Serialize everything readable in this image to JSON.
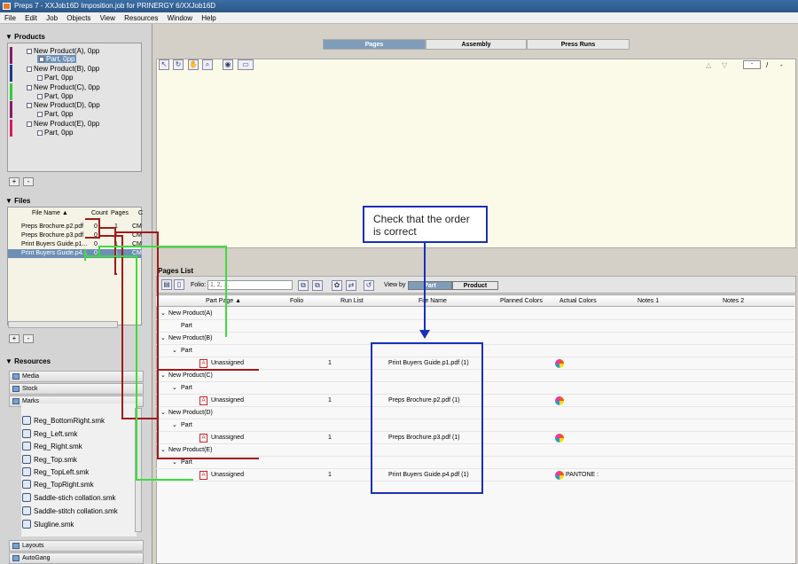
{
  "window": {
    "title": "Preps 7 - XXJob16D Imposition.job for PRINERGY 6/XXJob16D"
  },
  "menu": [
    "File",
    "Edit",
    "Job",
    "Objects",
    "View",
    "Resources",
    "Window",
    "Help"
  ],
  "products_section": {
    "title": "Products",
    "items": [
      {
        "name": "New Product(A), 0pp",
        "part": "Part, 0pp",
        "color": "#8b1a6b"
      },
      {
        "name": "New Product(B), 0pp",
        "part": "Part, 0pp",
        "color": "#1a3a8b"
      },
      {
        "name": "New Product(C), 0pp",
        "part": "Part, 0pp",
        "color": "#2ecc40"
      },
      {
        "name": "New Product(D), 0pp",
        "part": "Part, 0pp",
        "color": "#8b1a6b"
      },
      {
        "name": "New Product(E), 0pp",
        "part": "Part, 0pp",
        "color": "#d81b60"
      }
    ],
    "add_label": "+",
    "remove_label": "-"
  },
  "files_section": {
    "title": "Files",
    "columns": {
      "file_name": "File Name ▲",
      "count": "Count",
      "pages": "Pages",
      "c": "C"
    },
    "rows": [
      {
        "name": "Preps Brochure.p2.pdf",
        "count": "0",
        "pages": "1",
        "c": "CM"
      },
      {
        "name": "Preps Brochure.p3.pdf",
        "count": "0",
        "pages": "1",
        "c": "CM"
      },
      {
        "name": "Print Buyers Guide.p1...",
        "count": "0",
        "pages": "1",
        "c": "CM"
      },
      {
        "name": "Print Buyers Guide.p4...",
        "count": "0",
        "pages": "1",
        "c": "CM"
      }
    ],
    "add_label": "+",
    "remove_label": "-"
  },
  "resources_section": {
    "title": "Resources",
    "categories": [
      "Media",
      "Stock",
      "Marks"
    ],
    "marks": [
      "Reg_BottomRight.smk",
      "Reg_Left.smk",
      "Reg_Right.smk",
      "Reg_Top.smk",
      "Reg_TopLeft.smk",
      "Reg_TopRight.smk",
      "Saddle-stich collation.smk",
      "Saddle-stitch collation.smk",
      "Slugline.smk"
    ],
    "bottom_categories": [
      "Layouts",
      "AutoGang"
    ]
  },
  "tabs": [
    "Pages",
    "Assembly",
    "Press Runs"
  ],
  "page_nav": {
    "current": "-",
    "separator": "/",
    "total": "-"
  },
  "pages_list": {
    "title": "Pages List",
    "folio_label": "Folio:",
    "folio_placeholder": "1, 2, ...",
    "view_by_label": "View by",
    "view_by_options": [
      "Part",
      "Product"
    ],
    "columns": [
      "Part Page ▲",
      "Folio",
      "Run List",
      "File Name",
      "Planned Colors",
      "Actual Colors",
      "Notes 1",
      "Notes 2"
    ],
    "rows": [
      {
        "level": 0,
        "label": "New Product(A)"
      },
      {
        "level": 1,
        "label": "Part"
      },
      {
        "level": 0,
        "label": "New Product(B)"
      },
      {
        "level": 1,
        "label": "Part"
      },
      {
        "level": 2,
        "label": "Unassigned",
        "run": "1",
        "file": "Print Buyers Guide.p1.pdf (1)",
        "colors": ""
      },
      {
        "level": 0,
        "label": "New Product(C)"
      },
      {
        "level": 1,
        "label": "Part"
      },
      {
        "level": 2,
        "label": "Unassigned",
        "run": "1",
        "file": "Preps Brochure.p2.pdf (1)",
        "colors": ""
      },
      {
        "level": 0,
        "label": "New Product(D)"
      },
      {
        "level": 1,
        "label": "Part"
      },
      {
        "level": 2,
        "label": "Unassigned",
        "run": "1",
        "file": "Preps Brochure.p3.pdf (1)",
        "colors": ""
      },
      {
        "level": 0,
        "label": "New Product(E)"
      },
      {
        "level": 1,
        "label": "Part"
      },
      {
        "level": 2,
        "label": "Unassigned",
        "run": "1",
        "file": "Print Buyers Guide.p4.pdf (1)",
        "colors": "PANTONE :"
      }
    ]
  },
  "callout": {
    "line1": "Check that the order",
    "line2": "is correct"
  }
}
